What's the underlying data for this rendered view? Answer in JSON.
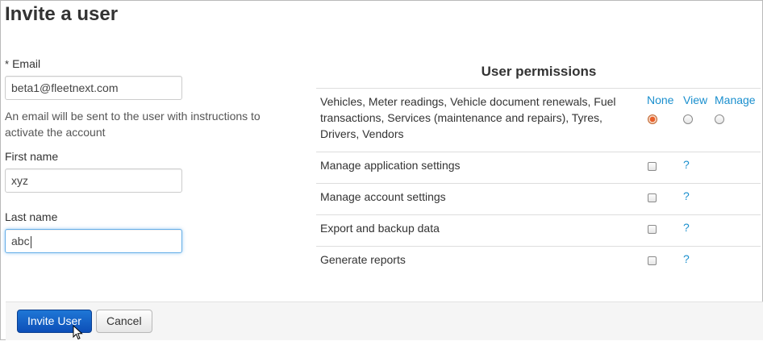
{
  "page": {
    "title": "Invite a user"
  },
  "form": {
    "email": {
      "required_marker": "*",
      "label": "Email",
      "value": "beta1@fleetnext.com"
    },
    "email_help": "An email will be sent to the user with instructions to activate the account",
    "first_name": {
      "label": "First name",
      "value": "xyz"
    },
    "last_name": {
      "label": "Last name",
      "value": "abc"
    }
  },
  "permissions": {
    "title": "User permissions",
    "columns": {
      "none": "None",
      "view": "View",
      "manage": "Manage"
    },
    "main_row": {
      "label": "Vehicles, Meter readings, Vehicle document renewals, Fuel transactions, Services (maintenance and repairs), Tyres, Drivers, Vendors",
      "selected": "none"
    },
    "rows": [
      {
        "label": "Manage application settings",
        "checked": false,
        "help": "?"
      },
      {
        "label": "Manage account settings",
        "checked": false,
        "help": "?"
      },
      {
        "label": "Export and backup data",
        "checked": false,
        "help": "?"
      },
      {
        "label": "Generate reports",
        "checked": false,
        "help": "?"
      }
    ]
  },
  "footer": {
    "invite_label": "Invite User",
    "cancel_label": "Cancel"
  },
  "colors": {
    "link": "#1a8fce",
    "primary_button": "#0d4fb8",
    "focus_ring": "#66afe9",
    "radio_selected": "#e8602a"
  },
  "icons": {
    "cursor": "mouse-pointer-icon"
  }
}
